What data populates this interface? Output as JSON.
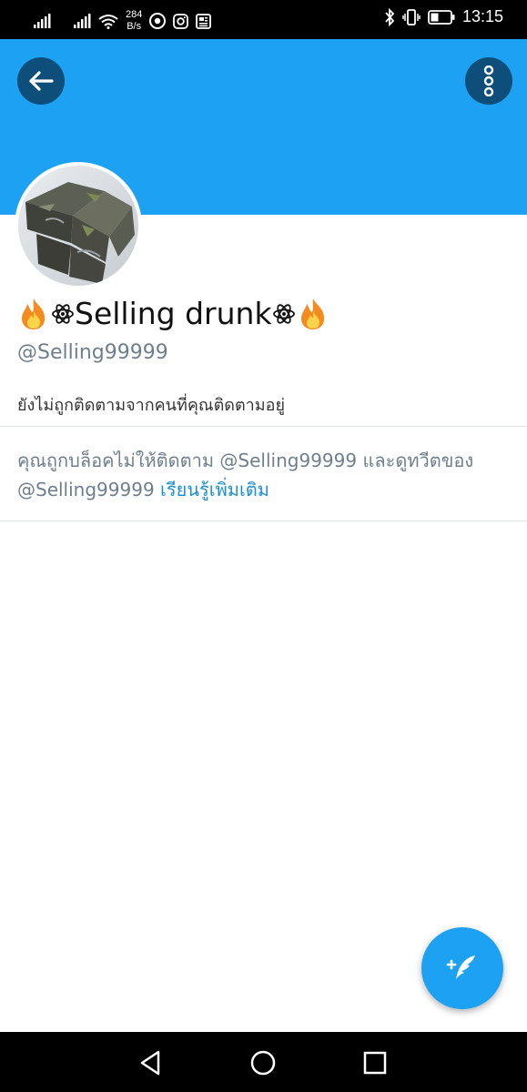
{
  "status_bar": {
    "net_speed_value": "284",
    "net_speed_unit": "B/s",
    "time": "13:15"
  },
  "profile": {
    "display_name": "Selling drunk",
    "handle": "@Selling99999",
    "follow_note": "ยังไม่ถูกติดตามจากคนที่คุณติดตามอยู่"
  },
  "blocked_notice": {
    "text_part1": "คุณถูกบล็อคไม่ให้ติดตาม ",
    "handle_1": "@Selling99999",
    "text_part2": " และดูทวีตของ ",
    "handle_2": "@Selling99999",
    "learn_more": "เรียนรู้เพิ่มเติม"
  },
  "icons": {
    "back": "arrow-left-icon",
    "more": "vertical-dots-icon",
    "compose": "compose-tweet-icon",
    "name_emoji": [
      "fire-icon",
      "atom-icon",
      "atom-icon",
      "fire-icon"
    ]
  },
  "colors": {
    "header_blue": "#1da1f2",
    "button_dark": "#0d4f7a",
    "link_blue": "#1b8fd2",
    "secondary_text": "#6e7f8c"
  }
}
